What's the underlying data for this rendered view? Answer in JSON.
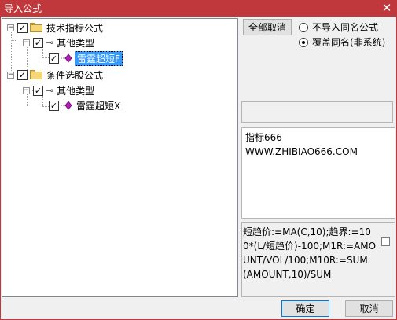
{
  "window": {
    "title": "导入公式",
    "close_glyph": "✕"
  },
  "tree": {
    "nodes": [
      {
        "label": "技术指标公式",
        "checked": true,
        "expander": "−"
      },
      {
        "label": "其他类型",
        "checked": true,
        "expander": "−"
      },
      {
        "label": "雷霆超短F",
        "checked": true,
        "selected": true
      },
      {
        "label": "条件选股公式",
        "checked": true,
        "expander": "−"
      },
      {
        "label": "其他类型",
        "checked": true,
        "expander": "−"
      },
      {
        "label": "雷霆超短X",
        "checked": true,
        "selected": false
      }
    ],
    "check_glyph": "✓"
  },
  "options": {
    "deselect_all_label": "全部取消",
    "radio_no_import_label": "不导入同名公式",
    "radio_overwrite_label": "覆盖同名(非系统)",
    "selected_radio": "overwrite"
  },
  "info_text": "指标666\nWWW.ZHIBIAO666.COM",
  "formula_preview": "短趋价:=MA(C,10);趋界:=100*(L/短趋价)-100;M1R:=AMOUNT/VOL/100;M10R:=SUM(AMOUNT,10)/SUM",
  "footer": {
    "ok_label": "确定",
    "cancel_label": "取消"
  },
  "colors": {
    "titlebar": "#c0383b",
    "selection": "#3399ff",
    "formula_icon": "#b01cb8"
  }
}
